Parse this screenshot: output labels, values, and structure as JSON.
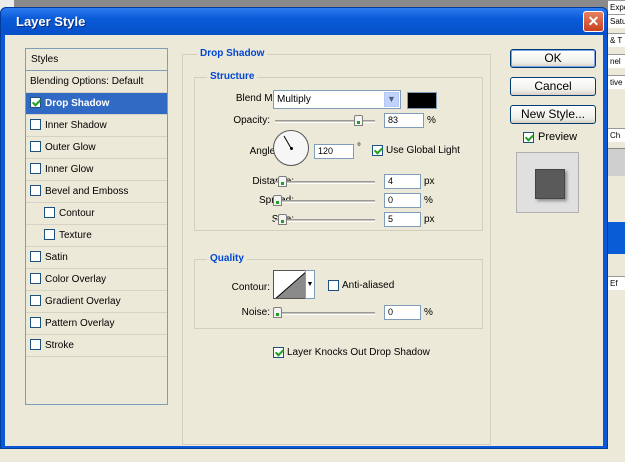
{
  "window": {
    "title": "Layer Style"
  },
  "background_app": {
    "right_strips": [
      "Exposur",
      "Satur",
      "& T",
      "nel",
      "tive",
      "Ch",
      "Ef"
    ]
  },
  "styles_list": {
    "header": "Styles",
    "items": [
      {
        "label": "Blending Options: Default",
        "checkbox": false,
        "checked": false,
        "selected": false,
        "indent": false
      },
      {
        "label": "Drop Shadow",
        "checkbox": true,
        "checked": true,
        "selected": true,
        "indent": false
      },
      {
        "label": "Inner Shadow",
        "checkbox": true,
        "checked": false,
        "selected": false,
        "indent": false
      },
      {
        "label": "Outer Glow",
        "checkbox": true,
        "checked": false,
        "selected": false,
        "indent": false
      },
      {
        "label": "Inner Glow",
        "checkbox": true,
        "checked": false,
        "selected": false,
        "indent": false
      },
      {
        "label": "Bevel and Emboss",
        "checkbox": true,
        "checked": false,
        "selected": false,
        "indent": false
      },
      {
        "label": "Contour",
        "checkbox": true,
        "checked": false,
        "selected": false,
        "indent": true
      },
      {
        "label": "Texture",
        "checkbox": true,
        "checked": false,
        "selected": false,
        "indent": true
      },
      {
        "label": "Satin",
        "checkbox": true,
        "checked": false,
        "selected": false,
        "indent": false
      },
      {
        "label": "Color Overlay",
        "checkbox": true,
        "checked": false,
        "selected": false,
        "indent": false
      },
      {
        "label": "Gradient Overlay",
        "checkbox": true,
        "checked": false,
        "selected": false,
        "indent": false
      },
      {
        "label": "Pattern Overlay",
        "checkbox": true,
        "checked": false,
        "selected": false,
        "indent": false
      },
      {
        "label": "Stroke",
        "checkbox": true,
        "checked": false,
        "selected": false,
        "indent": false
      }
    ]
  },
  "drop_shadow": {
    "title": "Drop Shadow",
    "structure": {
      "title": "Structure",
      "blend_mode_label": "Blend Mode:",
      "blend_mode_value": "Multiply",
      "shadow_color": "#000000",
      "opacity_label": "Opacity:",
      "opacity_value": "83",
      "opacity_unit": "%",
      "opacity_fraction": 0.83,
      "angle_label": "Angle:",
      "angle_value": "120",
      "angle_unit": "°",
      "use_global_light_label": "Use Global Light",
      "use_global_light_checked": true,
      "distance_label": "Distance:",
      "distance_value": "4",
      "distance_unit": "px",
      "spread_label": "Spread:",
      "spread_value": "0",
      "spread_unit": "%",
      "size_label": "Size:",
      "size_value": "5",
      "size_unit": "px"
    },
    "quality": {
      "title": "Quality",
      "contour_label": "Contour:",
      "anti_aliased_label": "Anti-aliased",
      "anti_aliased_checked": false,
      "noise_label": "Noise:",
      "noise_value": "0",
      "noise_unit": "%"
    },
    "layer_knocks_out_label": "Layer Knocks Out Drop Shadow",
    "layer_knocks_out_checked": true
  },
  "buttons": {
    "ok": "OK",
    "cancel": "Cancel",
    "new_style": "New Style...",
    "preview_label": "Preview",
    "preview_checked": true
  },
  "colors": {
    "title_bar": "#0a5ad8",
    "selection": "#316ac5",
    "group_title": "#0046d5",
    "preview_square": "#5a5a5a"
  }
}
